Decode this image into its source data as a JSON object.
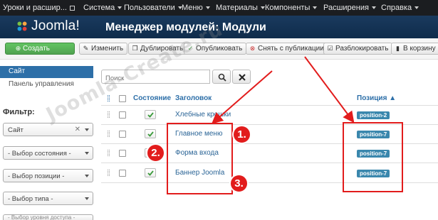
{
  "navbar": {
    "items": [
      {
        "label": "Уроки и расшир..."
      },
      {
        "label": "Система"
      },
      {
        "label": "Пользователи"
      },
      {
        "label": "Меню"
      },
      {
        "label": "Материалы"
      },
      {
        "label": "Компоненты"
      },
      {
        "label": "Расширения"
      },
      {
        "label": "Справка"
      }
    ]
  },
  "header": {
    "logo_text": "Joomla!",
    "title": "Менеджер модулей: Модули"
  },
  "toolbar": {
    "buttons": [
      {
        "label": "Создать",
        "icon": "plus-circle-icon"
      },
      {
        "label": "Изменить",
        "icon": "edit-icon"
      },
      {
        "label": "Дублировать",
        "icon": "copy-icon"
      },
      {
        "label": "Опубликовать",
        "icon": "check-icon"
      },
      {
        "label": "Снять с публикации",
        "icon": "circle-x-icon"
      },
      {
        "label": "Разблокировать",
        "icon": "checkbox-icon"
      },
      {
        "label": "В корзину",
        "icon": "trash-icon"
      }
    ]
  },
  "sidebar": {
    "active_item": "Сайт",
    "link_item": "Панель управления",
    "filter_title": "Фильтр:",
    "filters": [
      {
        "value": "Сайт"
      },
      {
        "value": "- Выбор состояния -"
      },
      {
        "value": "- Выбор позиции -"
      },
      {
        "value": "- Выбор типа -"
      },
      {
        "value": "- Выбор уровня доступа -"
      }
    ]
  },
  "search": {
    "placeholder": "Поиск"
  },
  "table": {
    "headers": {
      "state": "Состояние",
      "title": "Заголовок",
      "position": "Позиция ▲"
    },
    "rows": [
      {
        "title": "Хлебные крошки",
        "position": "position-2"
      },
      {
        "title": "Главное меню",
        "position": "position-7"
      },
      {
        "title": "Форма входа",
        "position": "position-7"
      },
      {
        "title": "Баннер Joomla",
        "position": "position-7"
      }
    ]
  },
  "annotations": {
    "numbers": [
      "1.",
      "2.",
      "3."
    ],
    "color": "#e21c1c"
  },
  "watermark": "Joomla-Create.ru",
  "colors": {
    "navbar": "#1b1d20",
    "header": "#0f2c4b",
    "accent": "#2d6fa8",
    "badge": "#3a87ad",
    "create_button": "#51a351"
  }
}
